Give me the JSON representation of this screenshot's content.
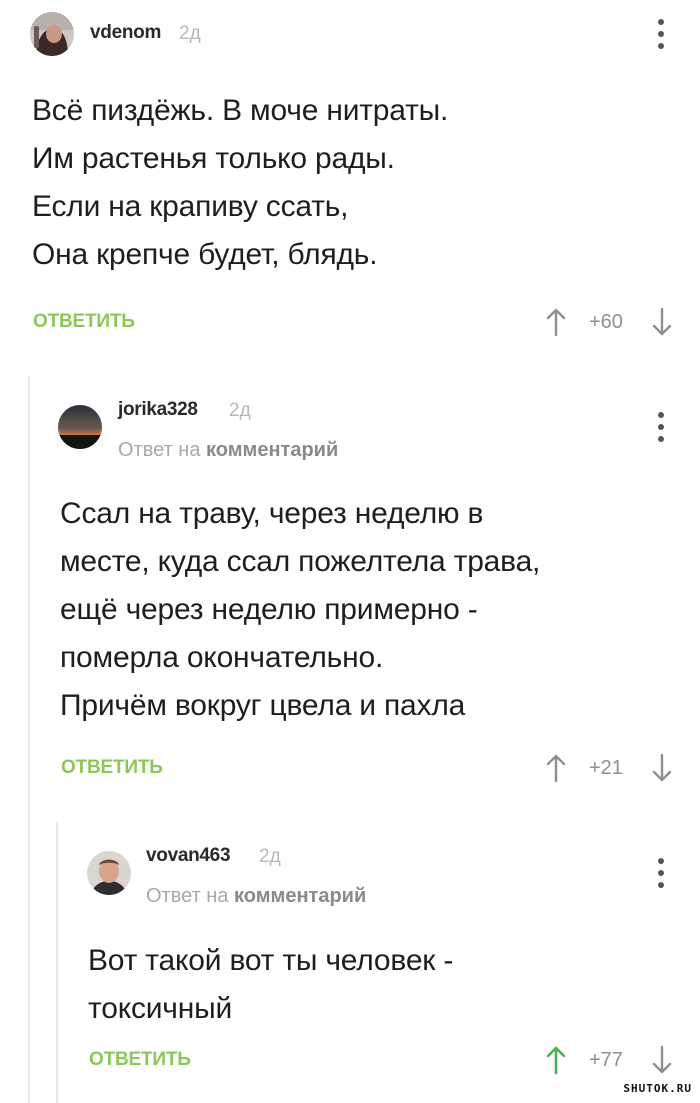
{
  "comments": [
    {
      "username": "vdenom",
      "time": "2д",
      "reply_to_prefix": "",
      "reply_to_link": "",
      "lines": [
        "Всё пиздёжь. В моче нитраты.",
        "Им растенья только рады.",
        "Если на крапиву ссать,",
        "Она крепче будет, блядь."
      ],
      "reply_label": "ОТВЕТИТЬ",
      "rating": "+60",
      "upvoted": false
    },
    {
      "username": "jorika328",
      "time": "2д",
      "reply_to_prefix": "Ответ на",
      "reply_to_link": "комментарий",
      "lines": [
        "Ссал на траву, через неделю в",
        "месте, куда ссал пожелтела трава,",
        "ещё через неделю примерно -",
        "померла окончательно.",
        "Причём вокруг цвела и пахла"
      ],
      "reply_label": "ОТВЕТИТЬ",
      "rating": "+21",
      "upvoted": false
    },
    {
      "username": "vovan463",
      "time": "2д",
      "reply_to_prefix": "Ответ на",
      "reply_to_link": "комментарий",
      "lines": [
        "Вот такой вот ты человек -",
        "токсичный"
      ],
      "reply_label": "ОТВЕТИТЬ",
      "rating": "+77",
      "upvoted": true
    }
  ],
  "colors": {
    "accent_green": "#8ac858",
    "rating_gray": "#8f8f8f",
    "upvote_active": "#4caf50"
  },
  "icons": {
    "menu": "vertical-dots-icon",
    "upvote": "arrow-up-icon",
    "downvote": "arrow-down-icon"
  },
  "watermark": "SHUTOK.RU"
}
